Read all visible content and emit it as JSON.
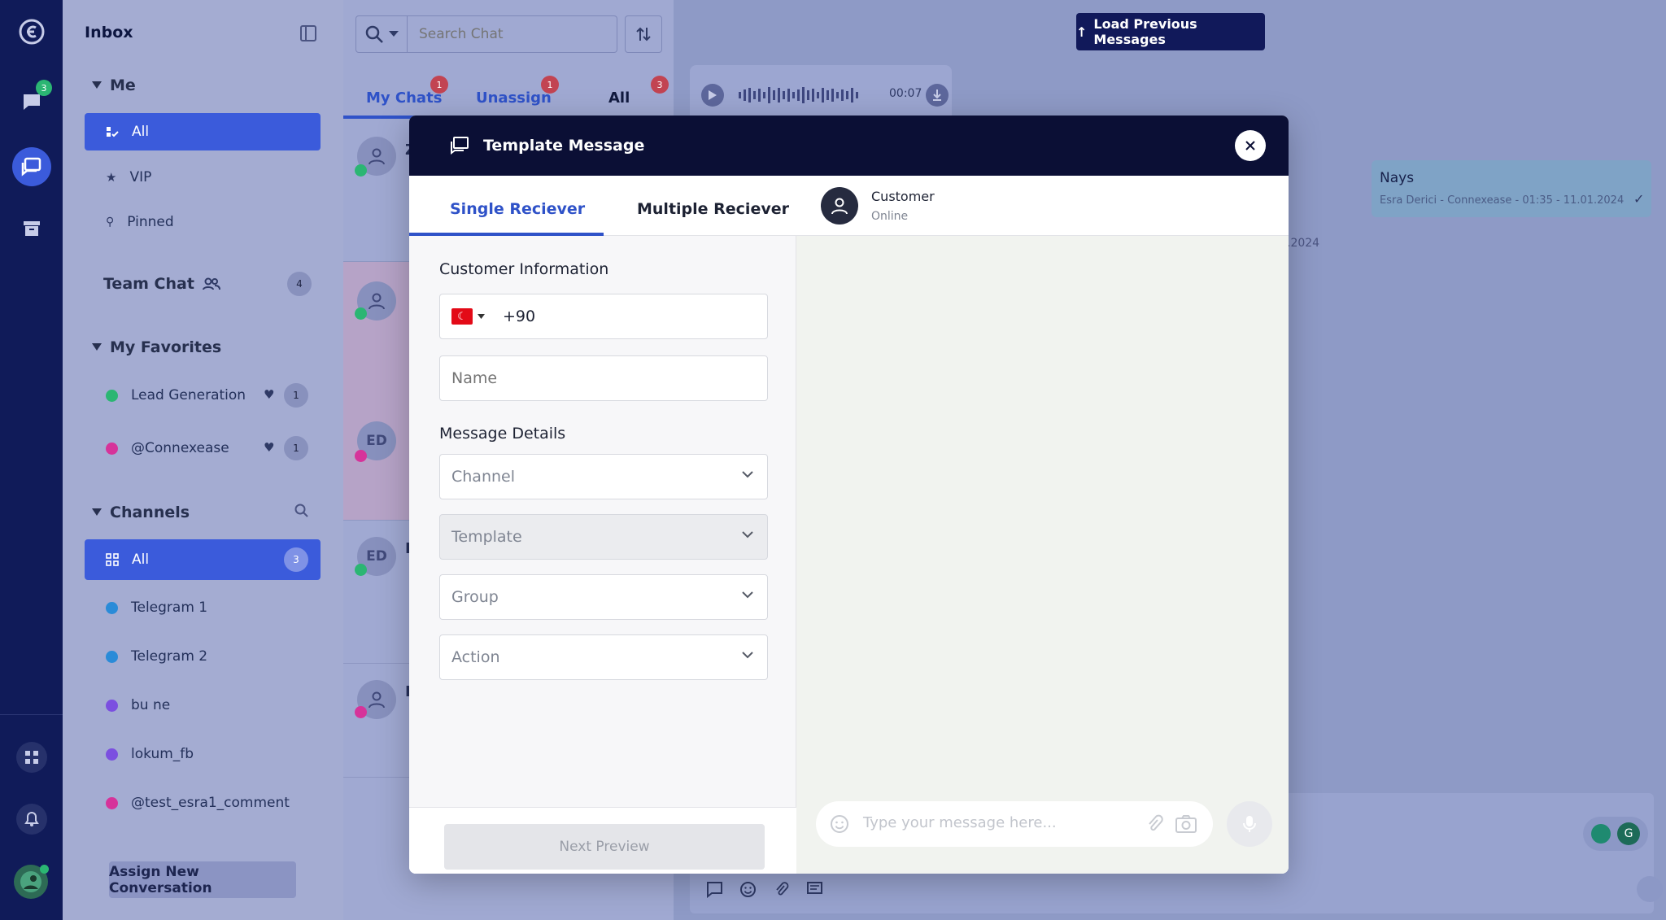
{
  "rail": {
    "chat_badge": "3"
  },
  "sidebar": {
    "title": "Inbox",
    "me": {
      "label": "Me",
      "items": [
        {
          "label": "All"
        },
        {
          "label": "VIP"
        },
        {
          "label": "Pinned"
        }
      ]
    },
    "team_chat": {
      "label": "Team Chat",
      "count": "4"
    },
    "favorites": {
      "label": "My Favorites",
      "items": [
        {
          "label": "Lead Generation",
          "count": "1",
          "channel_color": "#2bb673"
        },
        {
          "label": "@Connexease",
          "count": "1",
          "channel_color": "#d6339a"
        }
      ]
    },
    "channels": {
      "label": "Channels",
      "items": [
        {
          "label": "All",
          "count": "3"
        },
        {
          "label": "Telegram 1",
          "channel_color": "#2a8bd8"
        },
        {
          "label": "Telegram 2",
          "channel_color": "#2a8bd8"
        },
        {
          "label": "bu ne",
          "channel_color": "#7b4fe0"
        },
        {
          "label": "lokum_fb",
          "channel_color": "#7b4fe0"
        },
        {
          "label": "@test_esra1_comment",
          "channel_color": "#d6339a"
        }
      ]
    },
    "assign_button": "Assign New Conversation"
  },
  "chatlist": {
    "search_placeholder": "Search Chat",
    "tabs": [
      {
        "label": "My Chats",
        "badge": "1"
      },
      {
        "label": "Unassign",
        "badge": "1"
      },
      {
        "label": "All",
        "badge": "3"
      }
    ],
    "rows": [
      {
        "initials": "",
        "letter": "Z"
      },
      {
        "initials": "",
        "letter": ""
      },
      {
        "initials": "ED",
        "letter": ""
      },
      {
        "initials": "ED",
        "letter": "E"
      },
      {
        "initials": "",
        "letter": "E"
      }
    ]
  },
  "conversation": {
    "load_previous": "Load Previous Messages",
    "audio_duration": "00:07",
    "message": {
      "text": "Nays",
      "meta": "Esra Derici - Connexease - 01:35 - 11.01.2024"
    },
    "date_fragment": ".2024"
  },
  "modal": {
    "title": "Template Message",
    "tabs": {
      "single": "Single Reciever",
      "multiple": "Multiple Reciever"
    },
    "customer_info_label": "Customer Information",
    "phone_code": "+90",
    "name_placeholder": "Name",
    "message_details_label": "Message Details",
    "channel_placeholder": "Channel",
    "template_placeholder": "Template",
    "group_placeholder": "Group",
    "action_placeholder": "Action",
    "next_button": "Next Preview",
    "preview": {
      "customer_name": "Customer",
      "customer_status": "Online",
      "input_placeholder": "Type your message here..."
    }
  },
  "colors": {
    "rail": "#101b59",
    "accent": "#3b5bdb",
    "modal_header": "#0b0f35",
    "badge_red": "#c24452",
    "online_green": "#2bb673"
  }
}
